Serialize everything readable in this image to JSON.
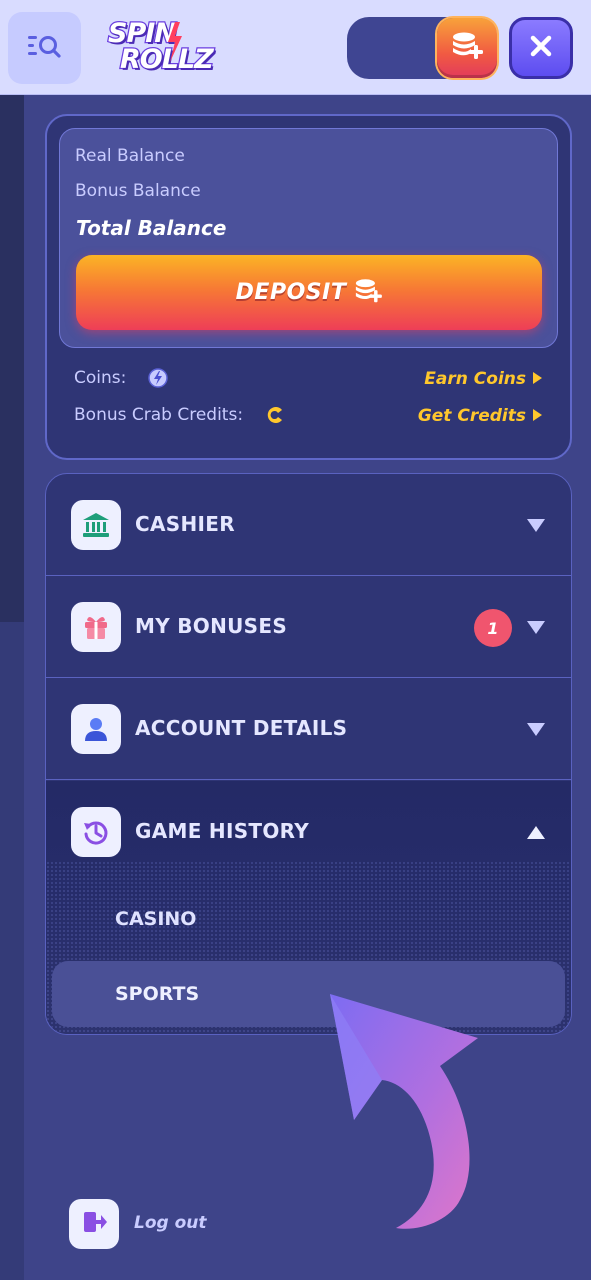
{
  "header": {
    "logo_line1": "SPIN",
    "logo_line2": "ROLLZ",
    "search_icon": "search-list-icon",
    "coin_add_icon": "coins-plus-icon",
    "close_icon": "close-icon"
  },
  "wallet": {
    "real_balance_label": "Real Balance",
    "bonus_balance_label": "Bonus Balance",
    "total_balance_label": "Total Balance",
    "deposit_label": "DEPOSIT",
    "coins_label": "Coins:",
    "crab_label": "Bonus Crab Credits:",
    "earn_coins_label": "Earn Coins",
    "get_credits_label": "Get Credits"
  },
  "menu": {
    "items": [
      {
        "label": "CASHIER",
        "icon": "bank-icon",
        "expanded": false
      },
      {
        "label": "MY BONUSES",
        "icon": "gift-icon",
        "badge": "1",
        "expanded": false
      },
      {
        "label": "ACCOUNT DETAILS",
        "icon": "user-icon",
        "expanded": false
      },
      {
        "label": "GAME HISTORY",
        "icon": "history-icon",
        "expanded": true
      }
    ],
    "game_history_sub": [
      "CASINO",
      "SPORTS"
    ]
  },
  "logout": {
    "label": "Log out",
    "icon": "logout-icon"
  },
  "colors": {
    "accent_gold": "#ffc72c",
    "deposit_top": "#fbb425",
    "deposit_bottom": "#ee3e57",
    "panel": "#2f3575",
    "badge": "#f0556e"
  }
}
